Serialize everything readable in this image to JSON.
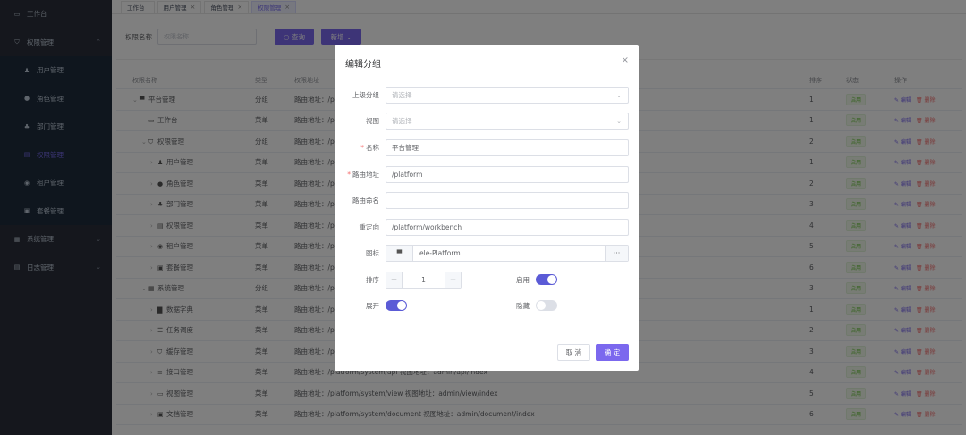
{
  "sidebar": {
    "items": [
      {
        "label": "工作台",
        "icon": "monitor-icon",
        "glyph": "▭",
        "type": "top",
        "arrow": ""
      },
      {
        "label": "权限管理",
        "icon": "shield-icon",
        "glyph": "⛉",
        "type": "top",
        "arrow": "⌃"
      },
      {
        "label": "用户管理",
        "icon": "user-icon",
        "glyph": "♟",
        "type": "sub",
        "arrow": ""
      },
      {
        "label": "角色管理",
        "icon": "role-icon",
        "glyph": "●",
        "type": "sub",
        "arrow": ""
      },
      {
        "label": "部门管理",
        "icon": "org-icon",
        "glyph": "♣",
        "type": "sub",
        "arrow": ""
      },
      {
        "label": "权限管理",
        "icon": "menu-icon",
        "glyph": "▤",
        "type": "sub active",
        "arrow": ""
      },
      {
        "label": "租户管理",
        "icon": "tenant-icon",
        "glyph": "◉",
        "type": "sub",
        "arrow": ""
      },
      {
        "label": "套餐管理",
        "icon": "package-icon",
        "glyph": "▣",
        "type": "sub",
        "arrow": ""
      },
      {
        "label": "系统管理",
        "icon": "windows-icon",
        "glyph": "▦",
        "type": "top",
        "arrow": "⌄"
      },
      {
        "label": "日志管理",
        "icon": "log-icon",
        "glyph": "▤",
        "type": "top",
        "arrow": "⌄"
      }
    ]
  },
  "tabs": [
    {
      "label": "工作台",
      "close": ""
    },
    {
      "label": "用户管理",
      "close": "×"
    },
    {
      "label": "角色管理",
      "close": "×"
    },
    {
      "label": "权限管理",
      "close": "×"
    }
  ],
  "search": {
    "label": "权限名称",
    "placeholder": "权限名称",
    "query_label": "○ 查询",
    "add_label": "新增 ⌄"
  },
  "table": {
    "headers": [
      "权限名称",
      "类型",
      "权限地址",
      "排序",
      "状态",
      "操作"
    ],
    "rows": [
      {
        "indent": 0,
        "toggle": "⌄",
        "icon": "▀",
        "name": "平台管理",
        "type": "分组",
        "addr": "路由地址：/p",
        "sort": "1"
      },
      {
        "indent": 1,
        "toggle": "",
        "icon": "▭",
        "name": "工作台",
        "type": "菜单",
        "addr": "路由地址：/p",
        "sort": "1"
      },
      {
        "indent": 1,
        "toggle": "⌄",
        "icon": "⛉",
        "name": "权限管理",
        "type": "分组",
        "addr": "路由地址：/p",
        "sort": "2"
      },
      {
        "indent": 2,
        "toggle": "›",
        "icon": "♟",
        "name": "用户管理",
        "type": "菜单",
        "addr": "路由地址：/p",
        "sort": "1"
      },
      {
        "indent": 2,
        "toggle": "›",
        "icon": "●",
        "name": "角色管理",
        "type": "菜单",
        "addr": "路由地址：/p",
        "sort": "2"
      },
      {
        "indent": 2,
        "toggle": "›",
        "icon": "♣",
        "name": "部门管理",
        "type": "菜单",
        "addr": "路由地址：/p",
        "sort": "3"
      },
      {
        "indent": 2,
        "toggle": "›",
        "icon": "▤",
        "name": "权限管理",
        "type": "菜单",
        "addr": "路由地址：/p",
        "sort": "4"
      },
      {
        "indent": 2,
        "toggle": "›",
        "icon": "◉",
        "name": "租户管理",
        "type": "菜单",
        "addr": "路由地址：/p",
        "sort": "5"
      },
      {
        "indent": 2,
        "toggle": "›",
        "icon": "▣",
        "name": "套餐管理",
        "type": "菜单",
        "addr": "路由地址：/p",
        "sort": "6"
      },
      {
        "indent": 1,
        "toggle": "⌄",
        "icon": "▦",
        "name": "系统管理",
        "type": "分组",
        "addr": "路由地址：/p",
        "sort": "3"
      },
      {
        "indent": 2,
        "toggle": "›",
        "icon": "▇",
        "name": "数据字典",
        "type": "菜单",
        "addr": "路由地址：/p",
        "sort": "1"
      },
      {
        "indent": 2,
        "toggle": "›",
        "icon": "☰",
        "name": "任务调度",
        "type": "菜单",
        "addr": "路由地址：/p",
        "sort": "2"
      },
      {
        "indent": 2,
        "toggle": "›",
        "icon": "⛉",
        "name": "缓存管理",
        "type": "菜单",
        "addr": "路由地址：/p",
        "sort": "3"
      },
      {
        "indent": 2,
        "toggle": "›",
        "icon": "≡",
        "name": "接口管理",
        "type": "菜单",
        "addr": "路由地址：/platform/system/api 视图地址：admin/api/index",
        "sort": "4"
      },
      {
        "indent": 2,
        "toggle": "›",
        "icon": "▭",
        "name": "视图管理",
        "type": "菜单",
        "addr": "路由地址：/platform/system/view 视图地址：admin/view/index",
        "sort": "5"
      },
      {
        "indent": 2,
        "toggle": "›",
        "icon": "▣",
        "name": "文档管理",
        "type": "菜单",
        "addr": "路由地址：/platform/system/document 视图地址：admin/document/index",
        "sort": "6"
      }
    ],
    "status_label": "启用",
    "edit_label": "✎ 编辑",
    "delete_label": "🗑 删除"
  },
  "dialog": {
    "title": "编辑分组",
    "close": "×",
    "fields": {
      "parent_label": "上级分组",
      "parent_placeholder": "请选择",
      "view_label": "视图",
      "view_placeholder": "请选择",
      "name_label": "名称",
      "name_value": "平台管理",
      "route_label": "路由地址",
      "route_value": "/platform",
      "route_name_label": "路由命名",
      "route_name_value": "",
      "redirect_label": "重定向",
      "redirect_value": "/platform/workbench",
      "icon_label": "图标",
      "icon_value": "ele-Platform",
      "icon_more": "···",
      "sort_label": "排序",
      "sort_value": "1",
      "enable_label": "启用",
      "enable_on": true,
      "expand_label": "展开",
      "expand_on": true,
      "hidden_label": "隐藏",
      "hidden_on": false
    },
    "cancel_label": "取 消",
    "ok_label": "确 定"
  }
}
